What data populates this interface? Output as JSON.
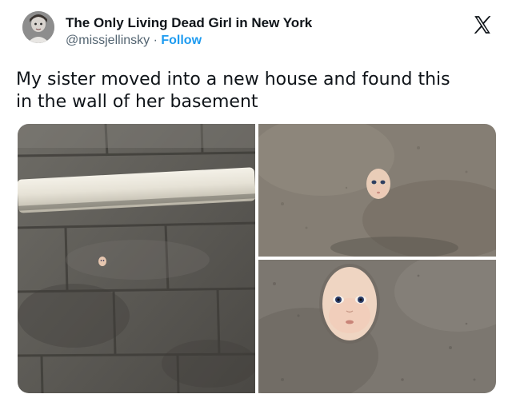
{
  "author": {
    "display_name": "The Only Living Dead Girl in New York",
    "handle": "@missjellinsky",
    "separator": " · ",
    "follow_label": "Follow",
    "avatar_icon": "avatar-portrait-icon"
  },
  "platform": {
    "logo_icon": "x-logo-icon"
  },
  "tweet": {
    "text_line1": "My sister moved into a new house and found this",
    "text_line2": "in the wall of her basement"
  },
  "media": {
    "photos": [
      {
        "subject": "basement-wall-with-pipe"
      },
      {
        "subject": "doll-face-in-wall-closeup"
      },
      {
        "subject": "doll-face-in-wall-extreme-closeup"
      }
    ]
  },
  "colors": {
    "follow_blue": "#1d9bf0",
    "handle_gray": "#536471",
    "text": "#0f1419"
  }
}
